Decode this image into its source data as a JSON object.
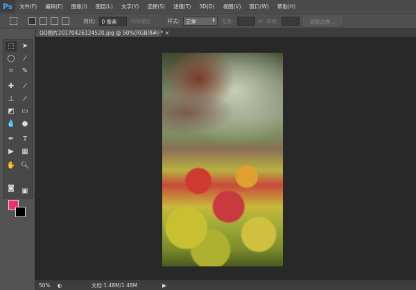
{
  "app": {
    "logo": "Ps"
  },
  "menu": [
    "文件(F)",
    "编辑(E)",
    "图像(I)",
    "图层(L)",
    "文字(Y)",
    "选择(S)",
    "滤镜(T)",
    "3D(D)",
    "视图(V)",
    "窗口(W)",
    "帮助(H)"
  ],
  "options": {
    "feather_label": "羽化:",
    "feather_value": "0 像素",
    "antialias_label": "消除锯齿",
    "style_label": "样式:",
    "style_value": "正常",
    "width_label": "宽度:",
    "height_label": "高度:",
    "refine_edge_label": "调整边缘..."
  },
  "document": {
    "tab_title": "QQ图片20170426124520.jpg @ 50%(RGB/8#) *",
    "close": "×"
  },
  "status": {
    "zoom": "50%",
    "doc_info": "文档:1.48M/1.48M"
  },
  "colors": {
    "foreground": "#f0306a",
    "background": "#000000"
  }
}
